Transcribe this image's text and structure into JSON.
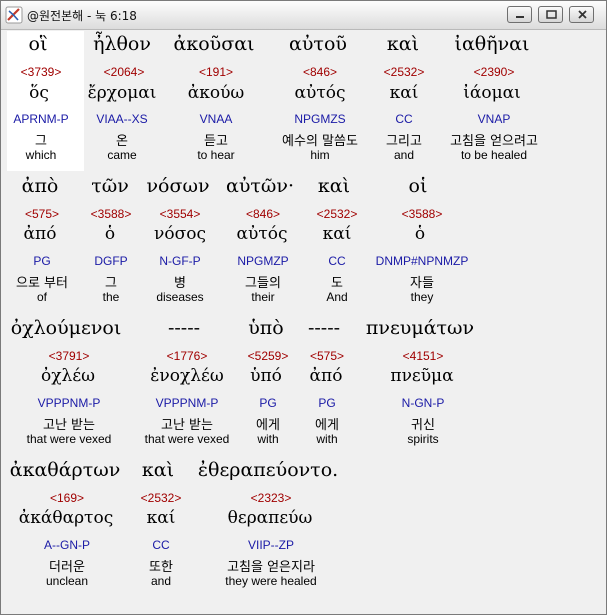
{
  "window": {
    "title": "@원전본해 - 눅 6:18"
  },
  "rows": [
    [
      {
        "greek": "οἳ",
        "strong": "<3739>",
        "lemma": "ὅς",
        "parse": "APRNM-P",
        "korean": "그",
        "english": "which"
      },
      {
        "greek": "ἦλθον",
        "strong": "<2064>",
        "lemma": "ἔρχομαι",
        "parse": "VIAA--XS",
        "korean": "온",
        "english": "came"
      },
      {
        "greek": "ἀκοῦσαι",
        "strong": "<191>",
        "lemma": "ἀκούω",
        "parse": "VNAA",
        "korean": "듣고",
        "english": "to hear"
      },
      {
        "greek": "αὐτοῦ",
        "strong": "<846>",
        "lemma": "αὐτός",
        "parse": "NPGMZS",
        "korean": "예수의 말씀도",
        "english": "him"
      },
      {
        "greek": "καὶ",
        "strong": "<2532>",
        "lemma": "καί",
        "parse": "CC",
        "korean": "그리고",
        "english": "and"
      },
      {
        "greek": "ἰαθῆναι",
        "strong": "<2390>",
        "lemma": "ἰάομαι",
        "parse": "VNAP",
        "korean": "고침을 얻으려고",
        "english": "to be healed"
      }
    ],
    [
      {
        "greek": "ἀπὸ",
        "strong": "<575>",
        "lemma": "ἀπό",
        "parse": "PG",
        "korean": "으로 부터",
        "english": "of"
      },
      {
        "greek": "τῶν",
        "strong": "<3588>",
        "lemma": "ὁ",
        "parse": "DGFP",
        "korean": "그",
        "english": "the"
      },
      {
        "greek": "νόσων",
        "strong": "<3554>",
        "lemma": "νόσος",
        "parse": "N-GF-P",
        "korean": "병",
        "english": "diseases"
      },
      {
        "greek": "αὐτῶν·",
        "strong": "<846>",
        "lemma": "αὐτός",
        "parse": "NPGMZP",
        "korean": "그들의",
        "english": "their"
      },
      {
        "greek": "καὶ",
        "strong": "<2532>",
        "lemma": "καί",
        "parse": "CC",
        "korean": "도",
        "english": "And"
      },
      {
        "greek": "οἱ",
        "strong": "<3588>",
        "lemma": "ὁ",
        "parse": "DNMP#NPNMZP",
        "korean": "자들",
        "english": "they"
      }
    ],
    [
      {
        "greek": "ὀχλούμενοι",
        "strong": "<3791>",
        "lemma": "ὀχλέω",
        "parse": "VPPPNM-P",
        "korean": "고난 받는",
        "english": "that were vexed"
      },
      {
        "greek": "-----",
        "strong": "<1776>",
        "lemma": "ἐνοχλέω",
        "parse": "VPPPNM-P",
        "korean": "고난 받는",
        "english": "that were vexed"
      },
      {
        "greek": "ὑπὸ",
        "strong": "<5259>",
        "lemma": "ὑπό",
        "parse": "PG",
        "korean": "에게",
        "english": "with"
      },
      {
        "greek": "-----",
        "strong": "<575>",
        "lemma": "ἀπό",
        "parse": "PG",
        "korean": "에게",
        "english": "with"
      },
      {
        "greek": "πνευμάτων",
        "strong": "<4151>",
        "lemma": "πνεῦμα",
        "parse": "N-GN-P",
        "korean": "귀신",
        "english": "spirits"
      }
    ],
    [
      {
        "greek": "ἀκαθάρτων",
        "strong": "<169>",
        "lemma": "ἀκάθαρτος",
        "parse": "A--GN-P",
        "korean": "더러운",
        "english": "unclean"
      },
      {
        "greek": "καὶ",
        "strong": "<2532>",
        "lemma": "καί",
        "parse": "CC",
        "korean": "또한",
        "english": "and"
      },
      {
        "greek": "ἐθεραπεύοντο.",
        "strong": "<2323>",
        "lemma": "θεραπεύω",
        "parse": "VIIP--ZP",
        "korean": "고침을 얻은지라",
        "english": "they were healed"
      }
    ]
  ]
}
